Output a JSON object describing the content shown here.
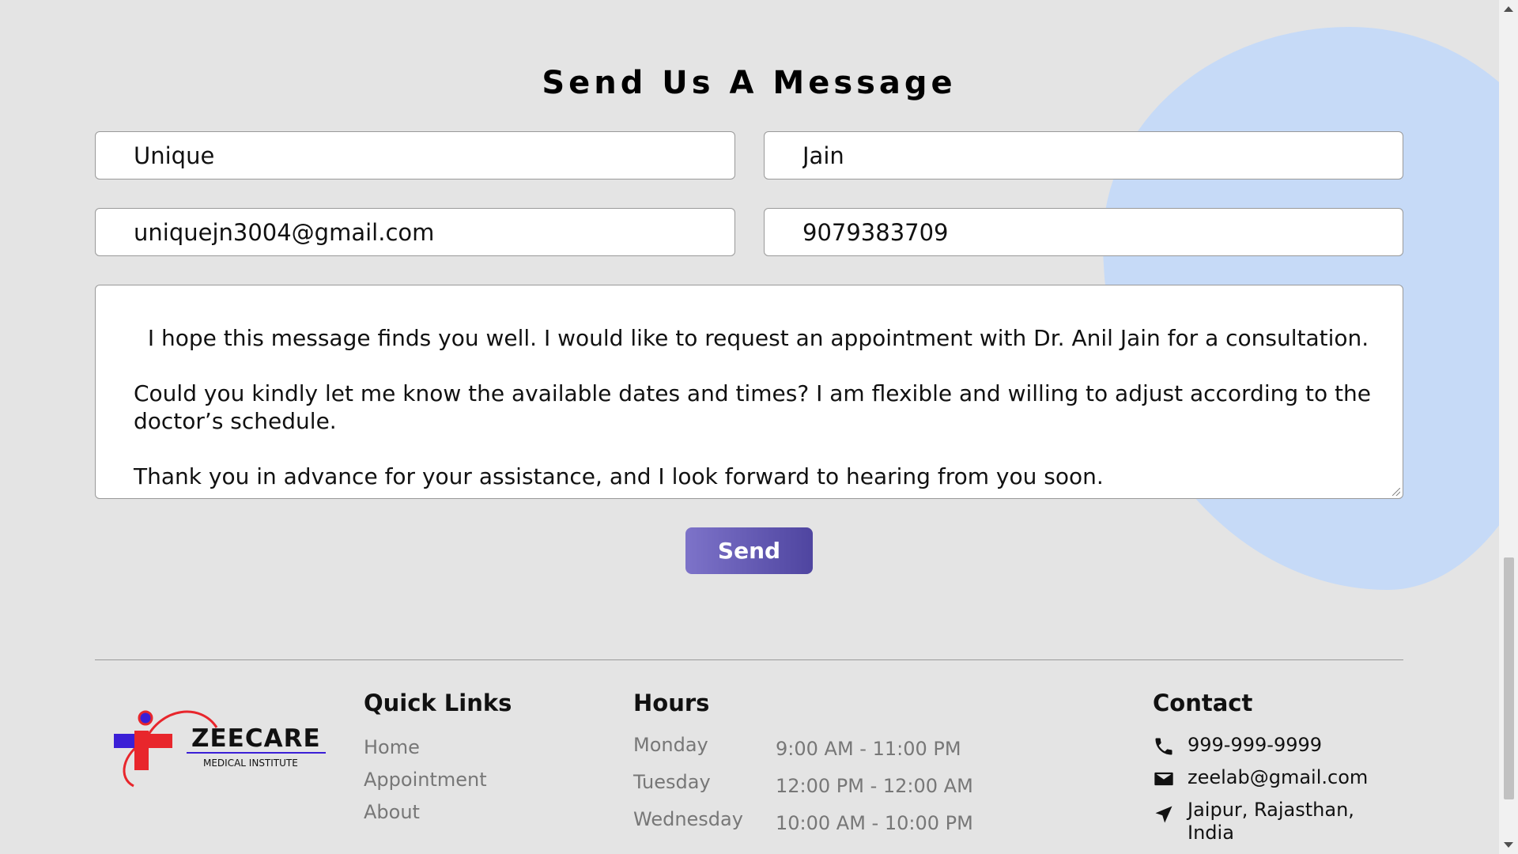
{
  "form": {
    "title": "Send Us A Message",
    "first_name": "Unique",
    "last_name": "Jain",
    "email": "uniquejn3004@gmail.com",
    "phone": "9079383709",
    "message": "I hope this message finds you well. I would like to request an appointment with Dr. Anil Jain for a consultation.\n\nCould you kindly let me know the available dates and times? I am flexible and willing to adjust according to the doctor’s schedule.\n\nThank you in advance for your assistance, and I look forward to hearing from you soon.",
    "send_label": "Send"
  },
  "footer": {
    "logo": {
      "name": "ZEECARE",
      "subtitle": "MEDICAL INSTITUTE"
    },
    "quick_links": {
      "title": "Quick Links",
      "items": [
        "Home",
        "Appointment",
        "About"
      ]
    },
    "hours": {
      "title": "Hours",
      "rows": [
        {
          "day": "Monday",
          "time": "9:00 AM - 11:00 PM"
        },
        {
          "day": "Tuesday",
          "time": "12:00 PM - 12:00 AM"
        },
        {
          "day": "Wednesday",
          "time": "10:00 AM - 10:00 PM"
        }
      ]
    },
    "contact": {
      "title": "Contact",
      "phone": "999-999-9999",
      "email": "zeelab@gmail.com",
      "address": "Jaipur, Rajasthan, India"
    }
  },
  "colors": {
    "background": "#e4e4e4",
    "accent_blob": "#c6daf7",
    "send_button_start": "#7d73c9",
    "send_button_end": "#4f45a0",
    "logo_red": "#e8262c",
    "logo_purple": "#3a1fd6"
  },
  "icons": [
    "phone-icon",
    "mail-icon",
    "location-arrow-icon"
  ]
}
